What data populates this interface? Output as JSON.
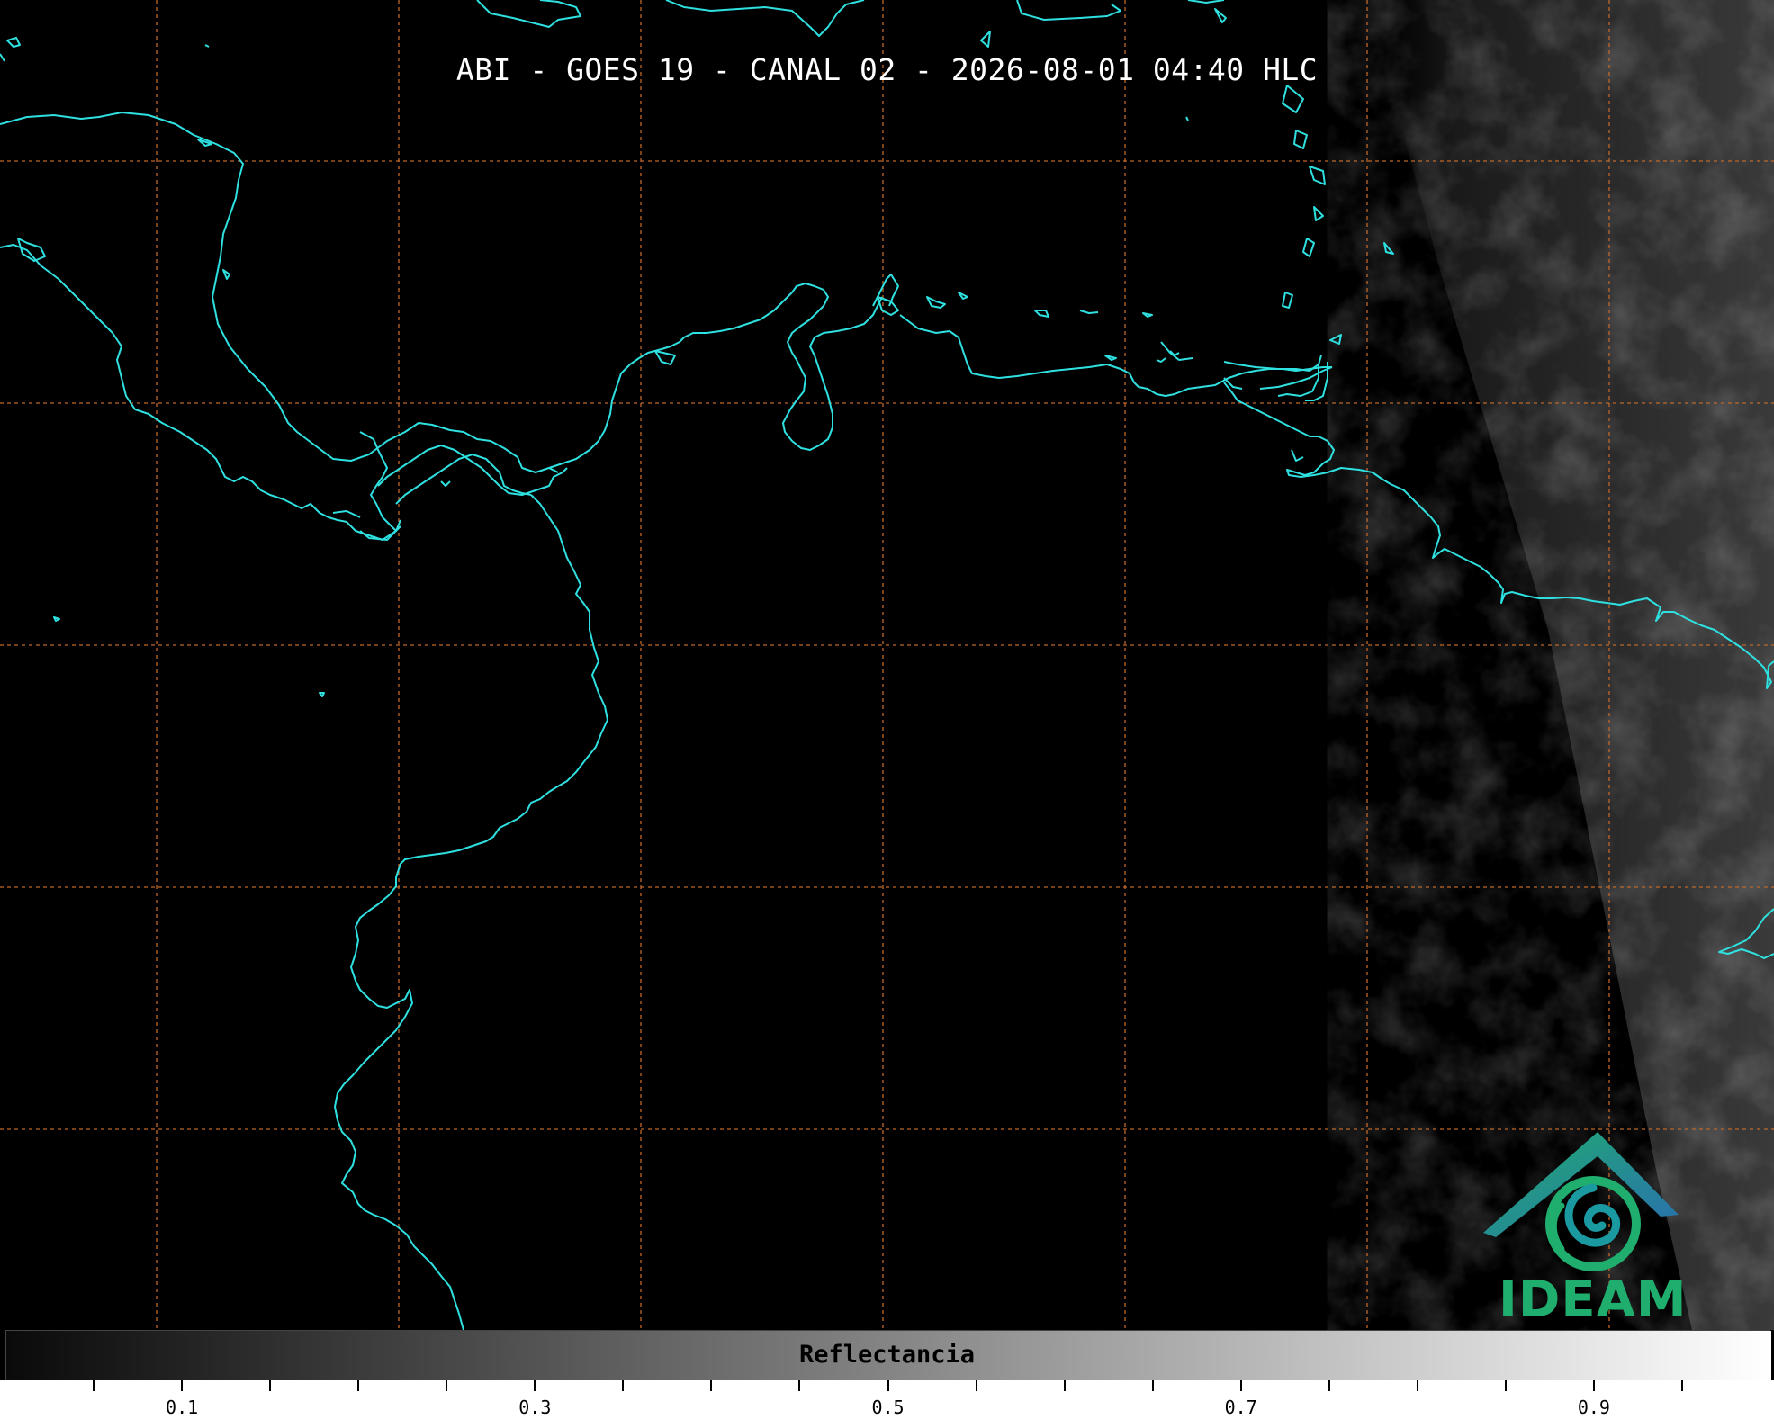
{
  "title": "ABI - GOES 19 - CANAL 02 - 2026-08-01 04:40 HLC",
  "colorbar": {
    "label": "Reflectancia",
    "tick_labels": [
      "0.1",
      "0.3",
      "0.5",
      "0.7",
      "0.9"
    ]
  },
  "logo": {
    "text": "IDEAM"
  },
  "colors": {
    "background": "#000000",
    "coastline": "#2fe0e0",
    "grid": "#c0672a",
    "logo_blue": "#2a6fb0",
    "logo_green": "#1fae6e"
  }
}
